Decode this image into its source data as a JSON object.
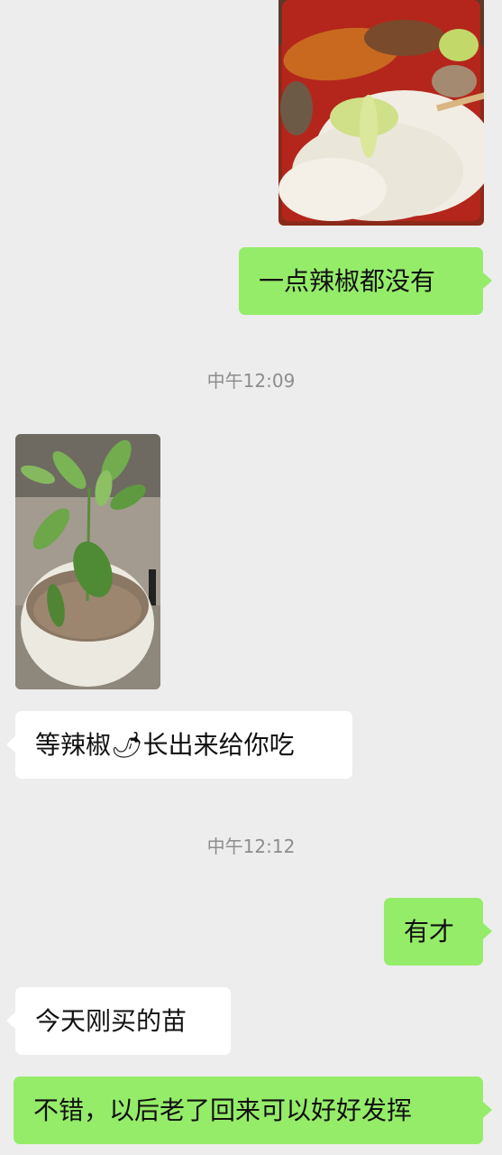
{
  "messages": [
    {
      "side": "out",
      "type": "image",
      "image": "bento-rice-fish-image"
    },
    {
      "side": "out",
      "type": "text",
      "text": "一点辣椒都没有"
    },
    {
      "type": "timestamp",
      "text": "中午12:09"
    },
    {
      "side": "in",
      "type": "image",
      "image": "potted-pepper-seedling-image"
    },
    {
      "side": "in",
      "type": "text",
      "text_before": "等辣椒",
      "emoji": "🌶",
      "text_after": "长出来给你吃"
    },
    {
      "type": "timestamp",
      "text": "中午12:12"
    },
    {
      "side": "out",
      "type": "text",
      "text": "有才"
    },
    {
      "side": "in",
      "type": "text",
      "text": "今天刚买的苗"
    },
    {
      "side": "out",
      "type": "text",
      "text": "不错，以后老了回来可以好好发挥"
    }
  ],
  "colors": {
    "background": "#ededed",
    "outgoing_bubble": "#95ec69",
    "incoming_bubble": "#ffffff",
    "timestamp": "#8d8d8d"
  }
}
